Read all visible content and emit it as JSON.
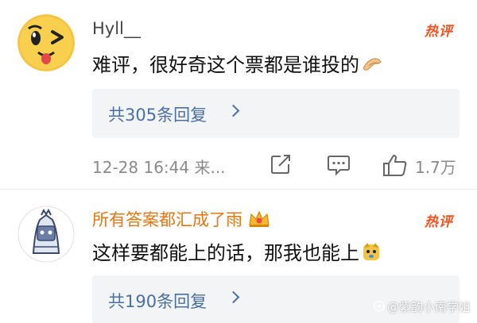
{
  "comments": [
    {
      "username": "Hyll__",
      "hot_badge": "热评",
      "text": "难评，很好奇这个票都是谁投的",
      "emoji_icon": "clapping-hands-icon",
      "replies_label": "共305条回复",
      "timestamp": "12-28 16:44",
      "source": "来...",
      "like_count": "1.7万"
    },
    {
      "username": "所有答案都汇成了雨",
      "vip_icon": "crown-icon",
      "hot_badge": "热评",
      "text": "这样要都能上的话，那我也能上",
      "emoji_icon": "doge-emoji-icon",
      "replies_label": "共190条回复"
    }
  ],
  "watermark": "@紫韵小南学姐",
  "colors": {
    "hot_badge": "#f4511e",
    "reply_link": "#4a6fa5",
    "vip_username": "#e8760e",
    "meta_text": "#8a8a8a"
  }
}
